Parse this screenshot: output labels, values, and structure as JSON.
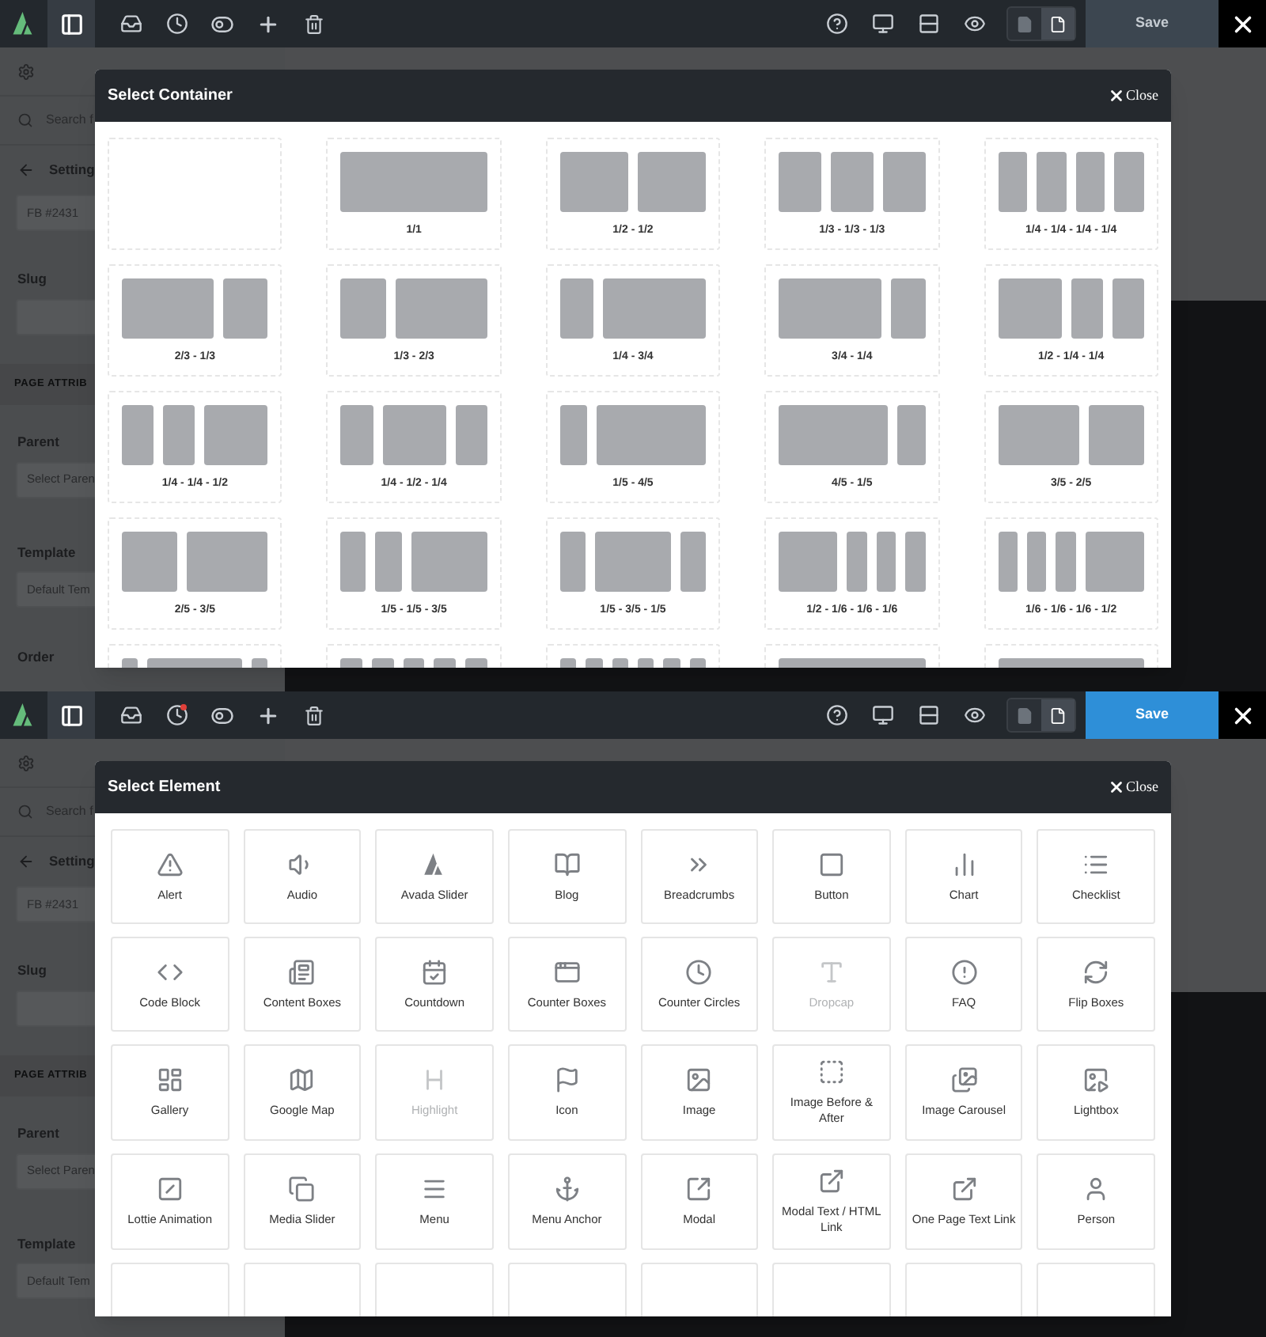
{
  "screens": [
    {
      "toolbar": {
        "sidebar_open": true,
        "history_badge": false,
        "view_modes": [
          {
            "selected": false
          },
          {
            "selected": true
          }
        ],
        "save": {
          "label": "Save",
          "enabled": false
        }
      },
      "sidebar": {
        "search": "Search f",
        "back": "Setting",
        "title_field": "FB #2431",
        "slug_label": "Slug",
        "section": "PAGE ATTRIB",
        "parent_label": "Parent",
        "parent_value": "Select Paren",
        "template_label": "Template",
        "template_value": "Default Tem",
        "order_label": "Order"
      },
      "modal": {
        "title": "Select Container",
        "close": "Close",
        "kind": "containers",
        "items": [
          {
            "kind": "blank"
          },
          {
            "kind": "c1",
            "label": "1/1"
          },
          {
            "kind": "c11",
            "label": "1/2 - 1/2"
          },
          {
            "kind": "c111",
            "label": "1/3 - 1/3 - 1/3"
          },
          {
            "kind": "c1111",
            "label": "1/4 - 1/4 - 1/4 - 1/4"
          },
          {
            "kind": "c21",
            "label": "2/3 - 1/3"
          },
          {
            "kind": "c12",
            "label": "1/3 - 2/3"
          },
          {
            "kind": "c13",
            "label": "1/4 - 3/4"
          },
          {
            "kind": "c31",
            "label": "3/4 - 1/4"
          },
          {
            "kind": "c211",
            "label": "1/2 - 1/4 - 1/4"
          },
          {
            "kind": "c112",
            "label": "1/4 - 1/4 - 1/2"
          },
          {
            "kind": "c121",
            "label": "1/4 - 1/2 - 1/4"
          },
          {
            "kind": "c14",
            "label": "1/5 - 4/5"
          },
          {
            "kind": "c41",
            "label": "4/5 - 1/5"
          },
          {
            "kind": "c32",
            "label": "3/5 - 2/5"
          },
          {
            "kind": "c23",
            "label": "2/5 - 3/5"
          },
          {
            "kind": "c113",
            "label": "1/5 - 1/5 - 3/5"
          },
          {
            "kind": "c131",
            "label": "1/5 - 3/5 - 1/5"
          },
          {
            "kind": "c3111",
            "label": "1/2 - 1/6 - 1/6 - 1/6"
          },
          {
            "kind": "c1113",
            "label": "1/6 - 1/6 - 1/6 - 1/2"
          },
          {
            "kind": "c161"
          },
          {
            "kind": "c11111"
          },
          {
            "kind": "c111111"
          },
          {
            "kind": "c1"
          },
          {
            "kind": "c1"
          }
        ]
      }
    },
    {
      "toolbar": {
        "sidebar_open": true,
        "history_badge": true,
        "view_modes": [
          {
            "selected": false
          },
          {
            "selected": true
          }
        ],
        "save": {
          "label": "Save",
          "enabled": true
        }
      },
      "sidebar": {
        "search": "Search f",
        "back": "Setting",
        "title_field": "FB #2431",
        "slug_label": "Slug",
        "section": "PAGE ATTRIB",
        "parent_label": "Parent",
        "parent_value": "Select Paren",
        "template_label": "Template",
        "template_value": "Default Tem"
      },
      "modal": {
        "title": "Select Element",
        "close": "Close",
        "kind": "elements",
        "items": [
          {
            "kind": "element",
            "label": "Alert",
            "disabled": false
          },
          {
            "kind": "element",
            "label": "Audio",
            "disabled": false
          },
          {
            "kind": "element",
            "label": "Avada Slider",
            "disabled": false
          },
          {
            "kind": "element",
            "label": "Blog",
            "disabled": false
          },
          {
            "kind": "element",
            "label": "Breadcrumbs",
            "disabled": false
          },
          {
            "kind": "element",
            "label": "Button",
            "disabled": false
          },
          {
            "kind": "element",
            "label": "Chart",
            "disabled": false
          },
          {
            "kind": "element",
            "label": "Checklist",
            "disabled": false
          },
          {
            "kind": "element",
            "label": "Code Block",
            "disabled": false
          },
          {
            "kind": "element",
            "label": "Content Boxes",
            "disabled": false
          },
          {
            "kind": "element",
            "label": "Countdown",
            "disabled": false
          },
          {
            "kind": "element",
            "label": "Counter Boxes",
            "disabled": false
          },
          {
            "kind": "element",
            "label": "Counter Circles",
            "disabled": false
          },
          {
            "kind": "element",
            "label": "Dropcap",
            "disabled": true
          },
          {
            "kind": "element",
            "label": "FAQ",
            "disabled": false
          },
          {
            "kind": "element",
            "label": "Flip Boxes",
            "disabled": false
          },
          {
            "kind": "element",
            "label": "Gallery",
            "disabled": false
          },
          {
            "kind": "element",
            "label": "Google Map",
            "disabled": false
          },
          {
            "kind": "element",
            "label": "Highlight",
            "disabled": true
          },
          {
            "kind": "element",
            "label": "Icon",
            "disabled": false
          },
          {
            "kind": "element",
            "label": "Image",
            "disabled": false
          },
          {
            "kind": "element",
            "label": "Image Before & After",
            "disabled": false
          },
          {
            "kind": "element",
            "label": "Image Carousel",
            "disabled": false
          },
          {
            "kind": "element",
            "label": "Lightbox",
            "disabled": false
          },
          {
            "kind": "element",
            "label": "Lottie Animation",
            "disabled": false
          },
          {
            "kind": "element",
            "label": "Media Slider",
            "disabled": false
          },
          {
            "kind": "element",
            "label": "Menu",
            "disabled": false
          },
          {
            "kind": "element",
            "label": "Menu Anchor",
            "disabled": false
          },
          {
            "kind": "element",
            "label": "Modal",
            "disabled": false
          },
          {
            "kind": "element",
            "label": "Modal Text / HTML Link",
            "disabled": false
          },
          {
            "kind": "element",
            "label": "One Page Text Link",
            "disabled": false
          },
          {
            "kind": "element",
            "label": "Person",
            "disabled": false
          },
          {
            "kind": "cut"
          },
          {
            "kind": "cut"
          },
          {
            "kind": "cut"
          },
          {
            "kind": "cut"
          },
          {
            "kind": "cut"
          },
          {
            "kind": "cut"
          },
          {
            "kind": "cut"
          },
          {
            "kind": "cut"
          }
        ]
      }
    }
  ]
}
